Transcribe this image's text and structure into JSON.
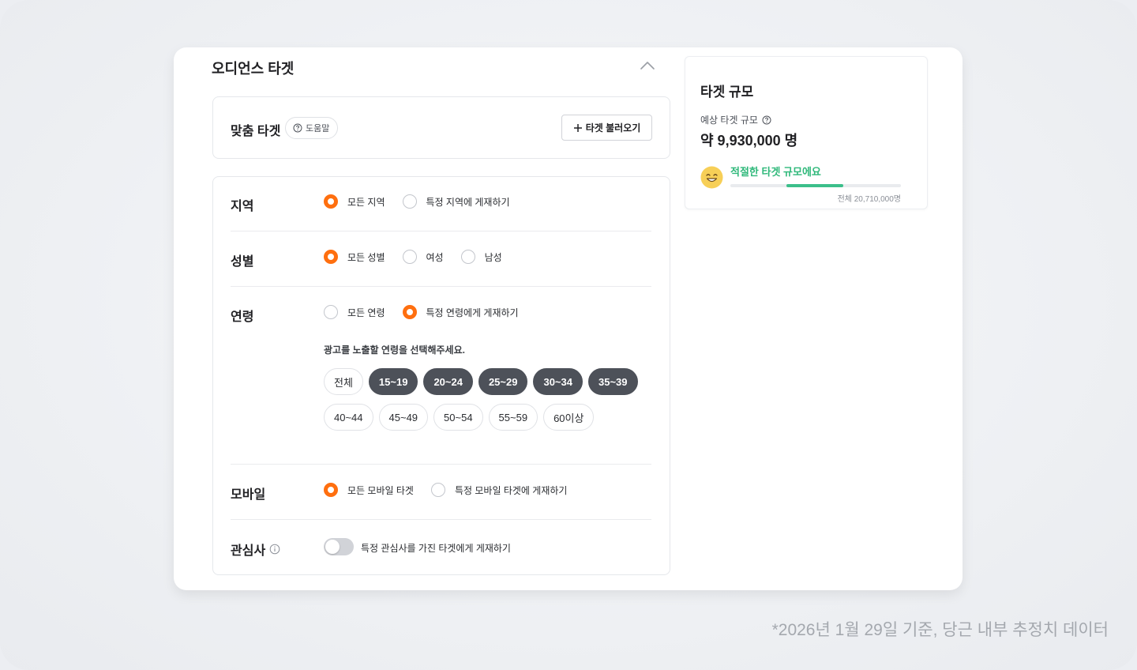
{
  "section": {
    "title": "오디언스 타겟"
  },
  "custom_target": {
    "label": "맞춤 타겟",
    "help_label": "도움말",
    "load_button": "타겟 불러오기"
  },
  "region": {
    "label": "지역",
    "options": [
      {
        "label": "모든 지역",
        "selected": true
      },
      {
        "label": "특정 지역에 게재하기",
        "selected": false
      }
    ]
  },
  "gender": {
    "label": "성별",
    "options": [
      {
        "label": "모든 성별",
        "selected": true
      },
      {
        "label": "여성",
        "selected": false
      },
      {
        "label": "남성",
        "selected": false
      }
    ]
  },
  "age": {
    "label": "연령",
    "options": [
      {
        "label": "모든 연령",
        "selected": false
      },
      {
        "label": "특정 연령에게 게재하기",
        "selected": true
      }
    ],
    "hint": "광고를 노출할 연령을 선택해주세요.",
    "chips_row1": [
      {
        "label": "전체",
        "selected": false
      },
      {
        "label": "15~19",
        "selected": true
      },
      {
        "label": "20~24",
        "selected": true
      },
      {
        "label": "25~29",
        "selected": true
      },
      {
        "label": "30~34",
        "selected": true
      },
      {
        "label": "35~39",
        "selected": true
      }
    ],
    "chips_row2": [
      {
        "label": "40~44",
        "selected": false
      },
      {
        "label": "45~49",
        "selected": false
      },
      {
        "label": "50~54",
        "selected": false
      },
      {
        "label": "55~59",
        "selected": false
      },
      {
        "label": "60이상",
        "selected": false
      }
    ]
  },
  "mobile": {
    "label": "모바일",
    "options": [
      {
        "label": "모든 모바일 타겟",
        "selected": true
      },
      {
        "label": "특정 모바일 타겟에 게재하기",
        "selected": false
      }
    ]
  },
  "interest": {
    "label": "관심사",
    "toggle_on": false,
    "toggle_text": "특정 관심사를 가진 타겟에게 게재하기"
  },
  "target_size": {
    "title": "타겟 규모",
    "estimate_label": "예상 타겟 규모",
    "estimate_value": "약 9,930,000 명",
    "status": "적절한 타겟 규모에요",
    "range_marker_fraction": {
      "start": 0.33,
      "end": 0.66
    },
    "total": "전체 20,710,000명"
  },
  "footnote": "*2026년 1월 29일 기준, 당근 내부 추정치 데이터",
  "colors": {
    "accent": "#ff6f0f",
    "chip_selected": "#4d5159",
    "status_green": "#2fb87a"
  }
}
